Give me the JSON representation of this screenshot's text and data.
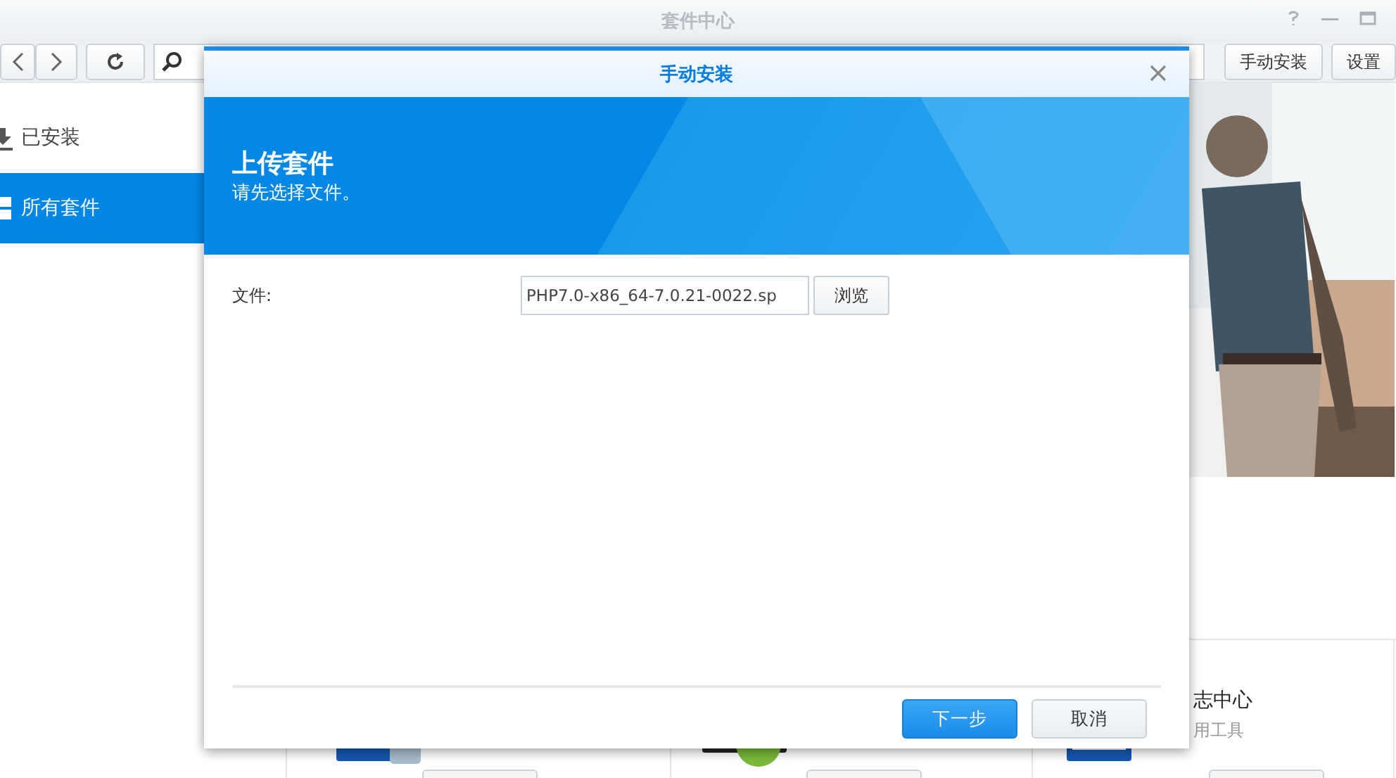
{
  "window": {
    "title": "套件中心"
  },
  "toolbar": {
    "buttons": [
      "手动安装",
      "设置"
    ]
  },
  "sidebar": {
    "items": [
      {
        "label": "已安装",
        "kind": "installed",
        "selected": false
      },
      {
        "label": "所有套件",
        "kind": "all",
        "selected": true
      }
    ]
  },
  "packages": [
    {
      "kind": "storage"
    },
    {
      "kind": "disc"
    },
    {
      "kind": "log",
      "name": "志中心",
      "category": "用工具"
    }
  ],
  "dialog": {
    "title": "手动安装",
    "header_title": "上传套件",
    "header_subtitle": "请先选择文件。",
    "file_label": "文件:",
    "file_value": "PHP7.0-x86_64-7.0.21-0022.sp",
    "browse_button": "浏览",
    "buttons": [
      {
        "label": "下一步",
        "kind": "primary"
      },
      {
        "label": "取消",
        "kind": "secondary"
      }
    ]
  }
}
